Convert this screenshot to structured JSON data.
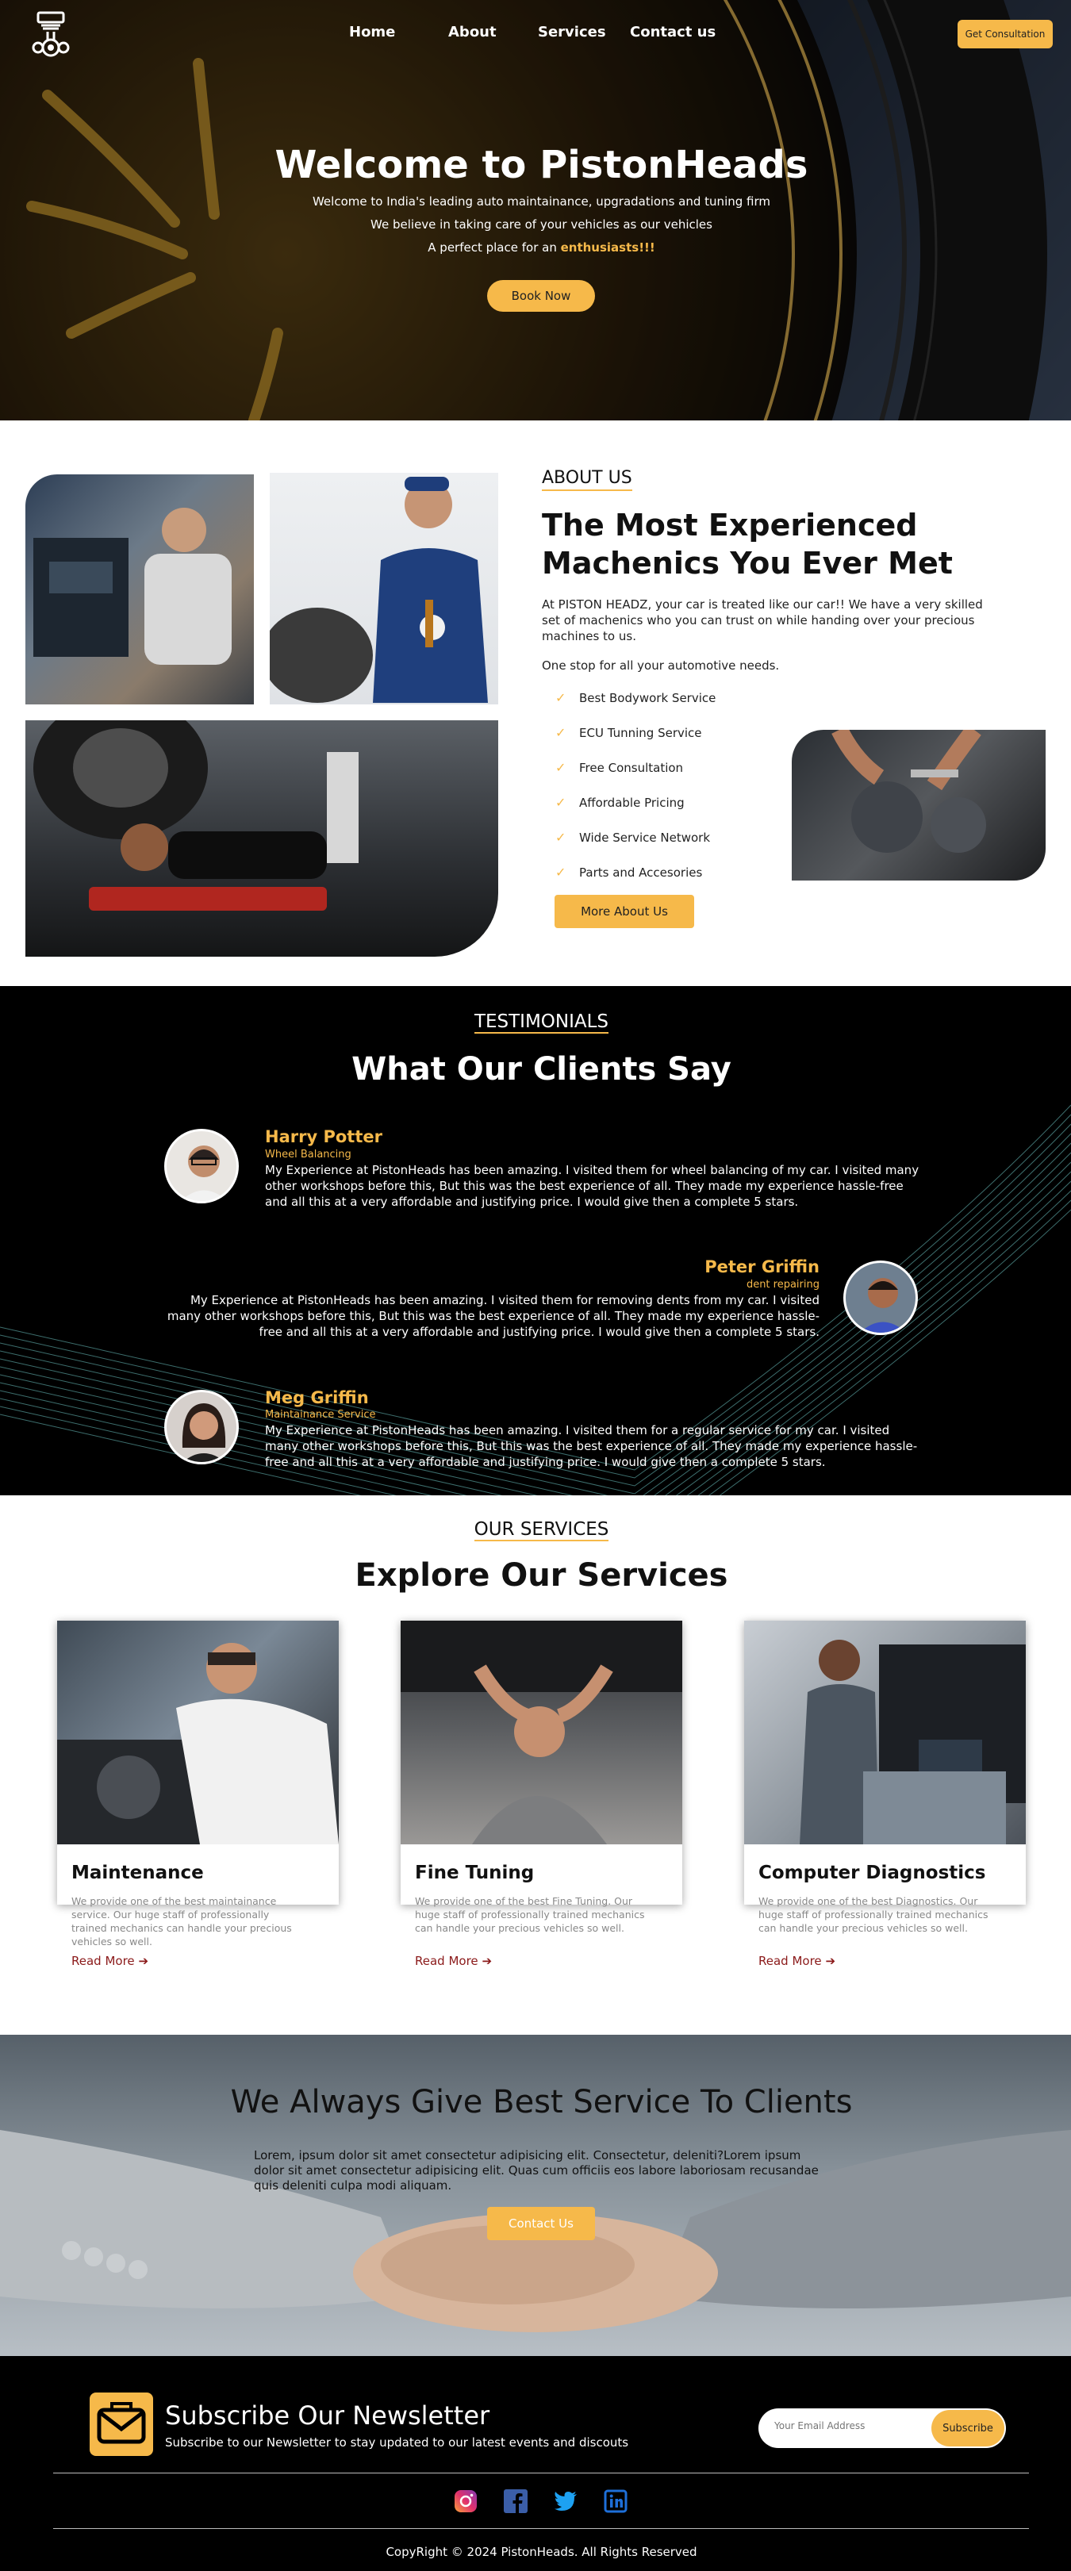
{
  "nav": {
    "links": [
      "Home",
      "About",
      "Services",
      "Contact us"
    ],
    "consult_label": "Get Consultation"
  },
  "hero": {
    "title": "Welcome to PistonHeads",
    "line1": "Welcome to India's leading auto maintainance, upgradations and tuning firm",
    "line2": "We believe in taking care of your vehicles as our vehicles",
    "line3_prefix": "A perfect place for an ",
    "line3_highlight": "enthusiasts!!!",
    "book_label": "Book Now"
  },
  "about": {
    "eyebrow": "ABOUT US",
    "title": "The Most Experienced Machenics You Ever Met",
    "desc": "At PISTON HEADZ, your car is treated like our car!! We have a very skilled set of machenics who you can trust on while handing over your precious machines to us.",
    "desc2": "One stop for all your automotive needs.",
    "features": [
      "Best Bodywork Service",
      "ECU Tunning Service",
      "Free Consultation",
      "Affordable Pricing",
      "Wide Service Network",
      "Parts and Accesories"
    ],
    "more_label": "More About Us"
  },
  "testimonials": {
    "eyebrow": "TESTIMONIALS",
    "title": "What Our Clients Say",
    "items": [
      {
        "name": "Harry Potter",
        "service": "Wheel Balancing",
        "text": "My Experience at PistonHeads has been amazing. I visited them for wheel balancing of my car. I visited many other workshops before this, But this was the best experience of all. They made my experience hassle-free and all this at a very affordable and justifying price. I would give then a complete 5 stars."
      },
      {
        "name": "Peter Griffin",
        "service": "dent repairing",
        "text": "My Experience at PistonHeads has been amazing. I visited them for removing dents from my car. I visited many other workshops before this, But this was the best experience of all. They made my experience hassle-free and all this at a very affordable and justifying price. I would give then a complete 5 stars."
      },
      {
        "name": "Meg Griffin",
        "service": "Maintainance Service",
        "text": "My Experience at PistonHeads has been amazing. I visited them for a regular service for my car. I visited many other workshops before this, But this was the best experience of all. They made my experience hassle-free and all this at a very affordable and justifying price. I would give then a complete 5 stars."
      }
    ]
  },
  "services": {
    "eyebrow": "OUR SERVICES",
    "title": "Explore Our Services",
    "cards": [
      {
        "title": "Maintenance",
        "desc": "We provide one of the best maintainance service. Our huge staff of professionally trained mechanics can handle your precious vehicles so well.",
        "more": "Read More"
      },
      {
        "title": "Fine Tuning",
        "desc": "We provide one of the best Fine Tuning. Our huge staff of professionally trained mechanics can handle your precious vehicles so well.",
        "more": "Read More"
      },
      {
        "title": "Computer Diagnostics",
        "desc": "We provide one of the best Diagnostics. Our huge staff of professionally trained mechanics can handle your precious vehicles so well.",
        "more": "Read More"
      }
    ]
  },
  "cta": {
    "title": "We Always Give Best Service To Clients",
    "desc": "Lorem, ipsum dolor sit amet consectetur adipisicing elit. Consectetur, deleniti?Lorem ipsum dolor sit amet consectetur adipisicing elit. Quas cum officiis eos labore laboriosam recusandae quis deleniti culpa modi aliquam.",
    "button": "Contact Us"
  },
  "newsletter": {
    "title": "Subscribe Our Newsletter",
    "subtitle": "Subscribe to our Newsletter to stay updated to our latest events and discouts",
    "email_placeholder": "Your Email Address",
    "button": "Subscribe"
  },
  "social": [
    "instagram-icon",
    "facebook-icon",
    "twitter-icon",
    "linkedin-icon"
  ],
  "copyright": "CopyRight © 2024 PistonHeads. All Rights Reserved",
  "colors": {
    "accent": "#f6b94a",
    "dark": "#000000",
    "link": "#8b1a1a"
  }
}
